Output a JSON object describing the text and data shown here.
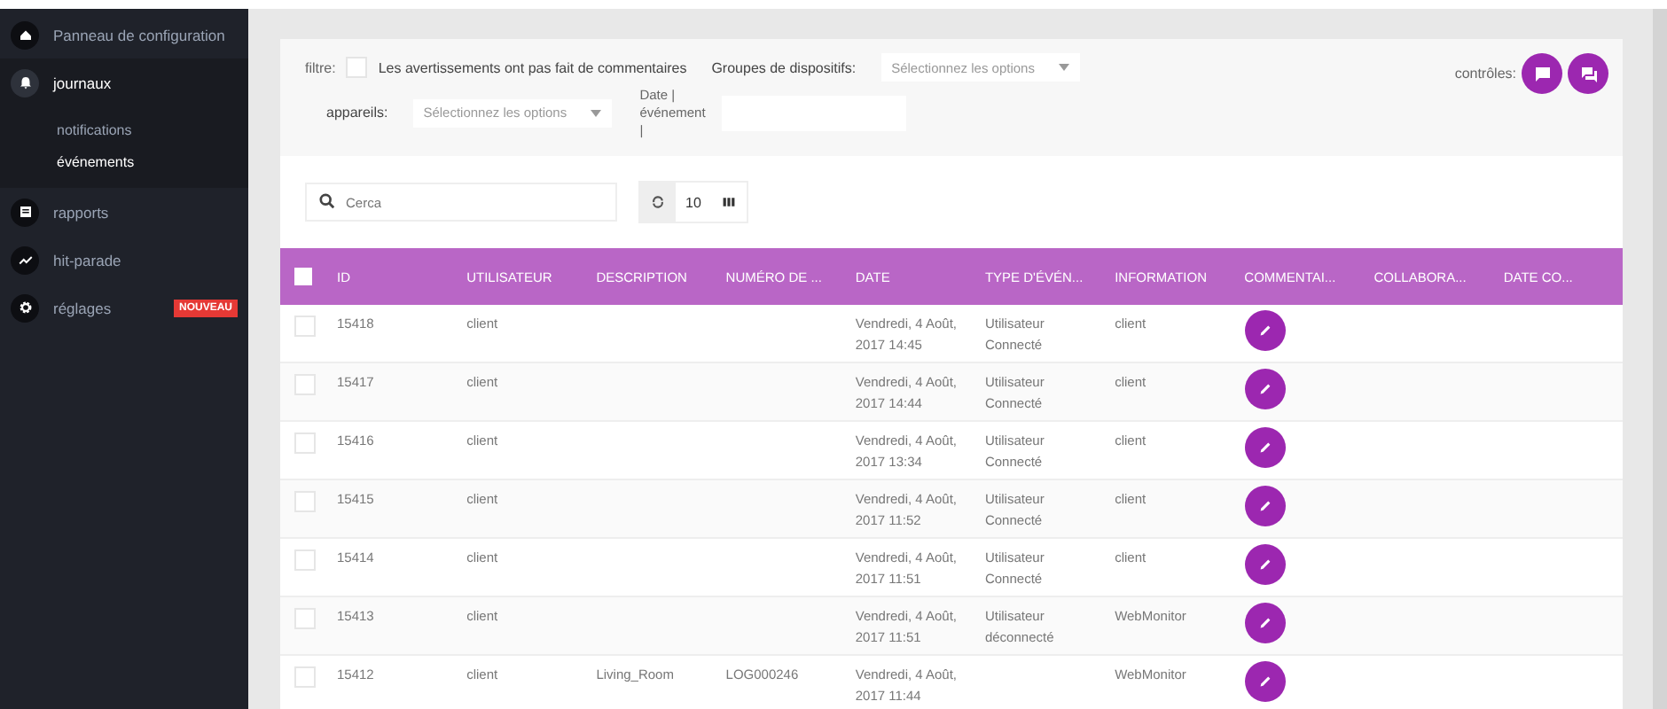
{
  "sidebar": {
    "items": [
      {
        "label": "Panneau de configuration",
        "selected": false
      },
      {
        "label": "journaux",
        "selected": true,
        "expanded": true,
        "children": [
          {
            "label": "notifications",
            "selected": false
          },
          {
            "label": "événements",
            "selected": true
          }
        ]
      },
      {
        "label": "rapports",
        "selected": false
      },
      {
        "label": "hit-parade",
        "selected": false
      },
      {
        "label": "réglages",
        "selected": false,
        "badge": "NOUVEAU"
      }
    ]
  },
  "filters": {
    "filter_label": "filtre:",
    "checkbox": {
      "label": "Les avertissements ont pas fait de commentaires",
      "checked": false
    },
    "device_groups": {
      "label": "Groupes de dispositifs:",
      "placeholder": "Sélectionnez les options"
    },
    "devices": {
      "label": "appareils:",
      "placeholder": "Sélectionnez les options"
    },
    "event_date": {
      "label": "Date | événement |"
    },
    "controls_label": "contrôles:"
  },
  "toolbar": {
    "search": {
      "placeholder": "Cerca"
    },
    "page_size": "10"
  },
  "table": {
    "header_checked": false,
    "columns": [
      "ID",
      "UTILISATEUR",
      "DESCRIPTION",
      "NUMÉRO DE ...",
      "DATE",
      "TYPE D'ÉVÉN...",
      "INFORMATION",
      "COMMENTAI...",
      "COLLABORA...",
      "DATE CO..."
    ],
    "rows": [
      {
        "checked": false,
        "cells": [
          "15418",
          "client",
          "",
          "",
          "Vendredi, 4 Août, 2017 14:45",
          "Utilisateur Connecté",
          "client"
        ]
      },
      {
        "checked": false,
        "cells": [
          "15417",
          "client",
          "",
          "",
          "Vendredi, 4 Août, 2017 14:44",
          "Utilisateur Connecté",
          "client"
        ]
      },
      {
        "checked": false,
        "cells": [
          "15416",
          "client",
          "",
          "",
          "Vendredi, 4 Août, 2017 13:34",
          "Utilisateur Connecté",
          "client"
        ]
      },
      {
        "checked": false,
        "cells": [
          "15415",
          "client",
          "",
          "",
          "Vendredi, 4 Août, 2017 11:52",
          "Utilisateur Connecté",
          "client"
        ]
      },
      {
        "checked": false,
        "cells": [
          "15414",
          "client",
          "",
          "",
          "Vendredi, 4 Août, 2017 11:51",
          "Utilisateur Connecté",
          "client"
        ]
      },
      {
        "checked": false,
        "cells": [
          "15413",
          "client",
          "",
          "",
          "Vendredi, 4 Août, 2017 11:51",
          "Utilisateur déconnecté",
          "WebMonitor"
        ]
      },
      {
        "checked": false,
        "cells": [
          "15412",
          "client",
          "Living_Room",
          "LOG000246",
          "Vendredi, 4 Août, 2017 11:44",
          "",
          "WebMonitor"
        ]
      }
    ]
  }
}
